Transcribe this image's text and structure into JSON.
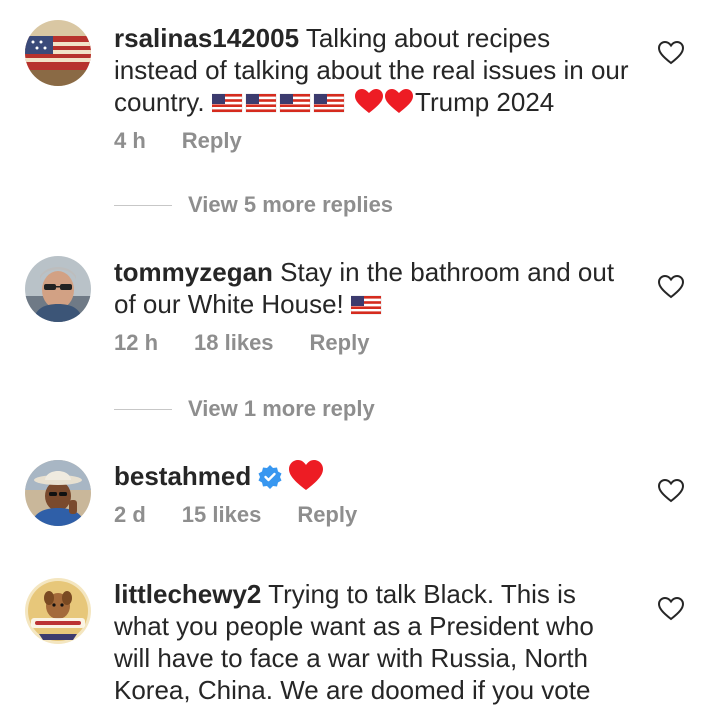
{
  "comments": [
    {
      "username": "rsalinas142005",
      "text_before": "Talking about recipes instead of talking about the real issues in our country.",
      "text_after": "Trump 2024",
      "time": "4 h",
      "likes": "",
      "reply": "Reply",
      "avatar_icon": "us-flag-avatar"
    },
    {
      "username": "tommyzegan",
      "text_before": "Stay in the bathroom and out of our White House!",
      "time": "12 h",
      "likes": "18 likes",
      "reply": "Reply",
      "avatar_icon": "man-sunglasses-avatar"
    },
    {
      "username": "bestahmed",
      "time": "2 d",
      "likes": "15 likes",
      "reply": "Reply",
      "avatar_icon": "man-cowboy-hat-avatar"
    },
    {
      "username": "littlechewy2",
      "text_before": "Trying to talk Black. This is what you people want as a President who will have to face a war with Russia, North Korea, China. We are doomed if you vote",
      "avatar_icon": "best-friends-avatar"
    }
  ],
  "view_more": [
    {
      "label": "View 5 more replies"
    },
    {
      "label": "View 1 more reply"
    }
  ],
  "colors": {
    "text": "#262626",
    "secondary": "#8e8e8e",
    "verified": "#3897f0",
    "heart_red": "#ed1c24"
  }
}
